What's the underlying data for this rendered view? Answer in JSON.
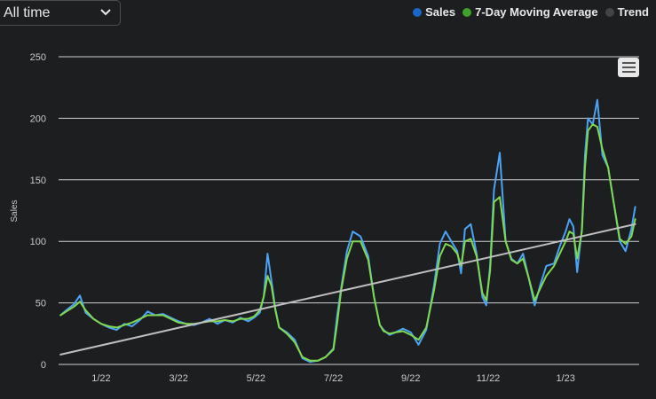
{
  "range_select": {
    "value": "All time",
    "icon": "chevron-down-icon"
  },
  "legend": [
    {
      "label": "Sales",
      "color": "#1a66c9"
    },
    {
      "label": "7-Day Moving Average",
      "color": "#3fa02b"
    },
    {
      "label": "Trend",
      "color": "#444444"
    }
  ],
  "menu_icon": "hamburger-menu-icon",
  "chart_data": {
    "type": "line",
    "ylabel": "Sales",
    "xlabel": "",
    "ylim": [
      0,
      250
    ],
    "yticks": [
      0,
      50,
      100,
      150,
      200,
      250
    ],
    "xtick_labels": [
      "1/22",
      "3/22",
      "5/22",
      "7/22",
      "9/22",
      "11/22",
      "1/23"
    ],
    "x_months": [
      0,
      2,
      4,
      6,
      8,
      10,
      12
    ],
    "xlim_months": [
      -1.1,
      13.9
    ],
    "grid": true,
    "series": [
      {
        "name": "Sales",
        "color": "#4aa3f5",
        "x": [
          -1.05,
          -0.9,
          -0.7,
          -0.55,
          -0.4,
          -0.2,
          0,
          0.2,
          0.4,
          0.6,
          0.8,
          1,
          1.2,
          1.4,
          1.6,
          1.8,
          2,
          2.2,
          2.4,
          2.6,
          2.8,
          3,
          3.2,
          3.4,
          3.6,
          3.8,
          3.95,
          4.1,
          4.2,
          4.3,
          4.4,
          4.5,
          4.6,
          4.8,
          5,
          5.2,
          5.4,
          5.6,
          5.8,
          6,
          6.1,
          6.2,
          6.35,
          6.5,
          6.7,
          6.9,
          7.05,
          7.2,
          7.3,
          7.45,
          7.6,
          7.8,
          8,
          8.2,
          8.4,
          8.6,
          8.75,
          8.9,
          9.05,
          9.2,
          9.3,
          9.4,
          9.55,
          9.7,
          9.85,
          9.95,
          10.05,
          10.15,
          10.3,
          10.45,
          10.6,
          10.75,
          10.9,
          11.05,
          11.2,
          11.35,
          11.5,
          11.7,
          11.85,
          12,
          12.1,
          12.2,
          12.3,
          12.42,
          12.5,
          12.58,
          12.7,
          12.82,
          12.95,
          13.1,
          13.25,
          13.4,
          13.55,
          13.7,
          13.8
        ],
        "values": [
          40,
          44,
          49,
          56,
          42,
          37,
          33,
          30,
          28,
          33,
          31,
          36,
          43,
          40,
          41,
          38,
          35,
          33,
          32,
          34,
          37,
          33,
          36,
          34,
          38,
          35,
          38,
          42,
          55,
          90,
          68,
          45,
          30,
          26,
          20,
          5,
          2,
          3,
          6,
          13,
          40,
          62,
          92,
          108,
          104,
          88,
          55,
          32,
          28,
          24,
          26,
          29,
          26,
          16,
          28,
          64,
          98,
          108,
          100,
          92,
          74,
          110,
          114,
          90,
          55,
          48,
          80,
          142,
          172,
          100,
          86,
          82,
          90,
          70,
          48,
          65,
          80,
          82,
          96,
          108,
          118,
          112,
          75,
          110,
          170,
          200,
          195,
          215,
          170,
          160,
          130,
          100,
          92,
          110,
          128
        ]
      },
      {
        "name": "7-Day Moving Average",
        "color": "#7fd94e",
        "x": [
          -1.05,
          -0.9,
          -0.7,
          -0.55,
          -0.4,
          -0.2,
          0,
          0.2,
          0.4,
          0.6,
          0.8,
          1,
          1.2,
          1.4,
          1.6,
          1.8,
          2,
          2.2,
          2.4,
          2.6,
          2.8,
          3,
          3.2,
          3.4,
          3.6,
          3.8,
          3.95,
          4.1,
          4.2,
          4.3,
          4.4,
          4.5,
          4.6,
          4.8,
          5,
          5.2,
          5.4,
          5.6,
          5.8,
          6,
          6.1,
          6.2,
          6.35,
          6.5,
          6.7,
          6.9,
          7.05,
          7.2,
          7.3,
          7.45,
          7.6,
          7.8,
          8,
          8.2,
          8.4,
          8.6,
          8.75,
          8.9,
          9.05,
          9.2,
          9.3,
          9.4,
          9.55,
          9.7,
          9.85,
          9.95,
          10.05,
          10.15,
          10.3,
          10.45,
          10.6,
          10.75,
          10.9,
          11.05,
          11.2,
          11.35,
          11.5,
          11.7,
          11.85,
          12,
          12.1,
          12.2,
          12.3,
          12.42,
          12.5,
          12.58,
          12.7,
          12.82,
          12.95,
          13.1,
          13.25,
          13.4,
          13.55,
          13.7,
          13.8
        ],
        "values": [
          40,
          43,
          47,
          51,
          44,
          37,
          33,
          31,
          30,
          32,
          34,
          37,
          40,
          40,
          40,
          37,
          34,
          33,
          33,
          34,
          35,
          35,
          36,
          35,
          37,
          37,
          39,
          44,
          55,
          72,
          64,
          44,
          30,
          25,
          18,
          6,
          3,
          3,
          6,
          12,
          34,
          60,
          86,
          100,
          100,
          85,
          55,
          32,
          27,
          25,
          26,
          27,
          24,
          20,
          30,
          60,
          88,
          98,
          96,
          90,
          80,
          100,
          102,
          88,
          58,
          52,
          76,
          132,
          136,
          100,
          85,
          82,
          86,
          70,
          52,
          62,
          72,
          80,
          90,
          100,
          108,
          106,
          86,
          108,
          160,
          190,
          195,
          193,
          175,
          160,
          130,
          102,
          98,
          104,
          118
        ]
      },
      {
        "name": "Trend",
        "color": "#bfbfbf",
        "x": [
          -1.05,
          13.8
        ],
        "values": [
          8,
          114
        ]
      }
    ]
  }
}
